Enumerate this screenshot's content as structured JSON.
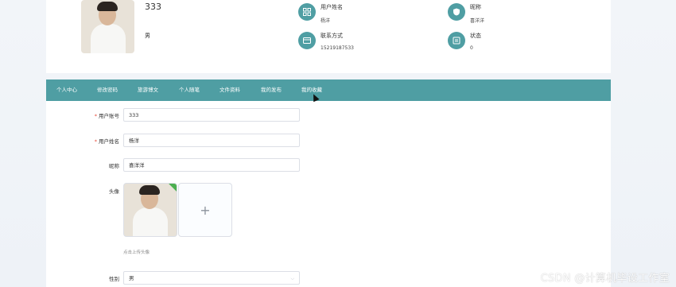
{
  "profile": {
    "account": "333",
    "gender": "男",
    "info": [
      {
        "label": "用户姓名",
        "value": "杨洋",
        "icon": "grid-icon"
      },
      {
        "label": "昵称",
        "value": "喜洋洋",
        "icon": "shield-icon"
      },
      {
        "label": "联系方式",
        "value": "15219187533",
        "icon": "card-icon"
      },
      {
        "label": "状态",
        "value": "0",
        "icon": "status-icon"
      }
    ]
  },
  "tabs": [
    {
      "label": "个人中心"
    },
    {
      "label": "修改密码"
    },
    {
      "label": "旅游博文"
    },
    {
      "label": "个人随笔"
    },
    {
      "label": "文件资料"
    },
    {
      "label": "我的发布"
    },
    {
      "label": "我的收藏"
    }
  ],
  "form": {
    "account_label": "用户账号",
    "account_value": "333",
    "name_label": "用户姓名",
    "name_value": "杨洋",
    "nickname_label": "昵称",
    "nickname_value": "喜洋洋",
    "avatar_label": "头像",
    "upload_plus": "+",
    "upload_hint": "点击上传头像",
    "gender_label": "性别",
    "gender_value": "男"
  },
  "colors": {
    "accent": "#4f9ea3",
    "required": "#e74c3c"
  },
  "watermark": "CSDN @计算机毕设工作室"
}
